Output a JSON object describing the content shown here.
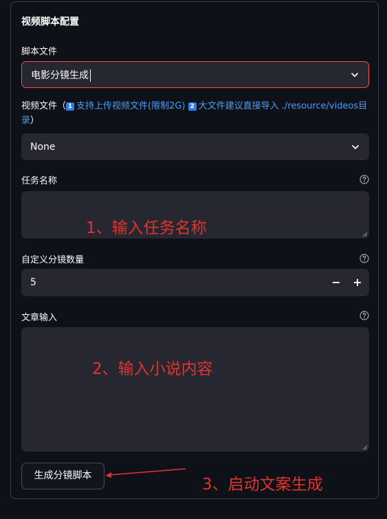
{
  "panel": {
    "title": "视频脚本配置"
  },
  "script_file": {
    "label": "脚本文件",
    "selected": "电影分镜生成"
  },
  "video_file": {
    "label_prefix": "视频文件（",
    "badge_1": "1",
    "link_1": "支持上传视频文件(限制2G)",
    "badge_2": "2",
    "link_2": "大文件建议直接导入 ./resource/videos目录",
    "label_suffix": "）",
    "selected": "None"
  },
  "task_name": {
    "label": "任务名称",
    "value": ""
  },
  "shot_count": {
    "label": "自定义分镜数量",
    "value": "5",
    "decrement_label": "−",
    "increment_label": "+"
  },
  "article": {
    "label": "文章输入",
    "value": ""
  },
  "generate_button": {
    "label": "生成分镜脚本"
  },
  "annotations": {
    "step1": "1、输入任务名称",
    "step2": "2、输入小说内容",
    "step3": "3、启动文案生成",
    "color": "#e2342d"
  },
  "colors": {
    "background": "#0e1117",
    "input_bg": "#262730",
    "focus_border": "#ff4b4b",
    "link": "#4c9cf7"
  },
  "icons": {
    "dropdown": "chevron-down-icon",
    "help": "help-circle-icon",
    "resize": "resize-handle-icon",
    "pointer": "red-arrow"
  }
}
